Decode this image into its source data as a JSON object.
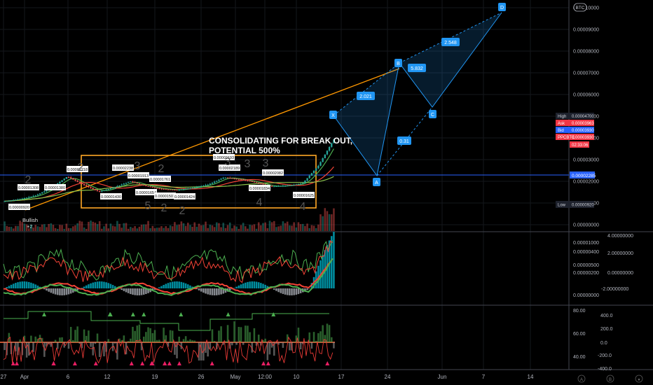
{
  "symbol_badge": "BTC",
  "colors": {
    "background": "#000000",
    "up": "#26a69a",
    "down": "#ef5350",
    "pattern": "#2196f3",
    "trendline": "#ff9800",
    "box": "#ffa726",
    "macd": "#00bcd4",
    "signal_green": "#4caf50",
    "signal_red": "#f44336"
  },
  "annotation": {
    "line1": "CONSOLIDATING FOR BREAK OUT,",
    "line2": "POTENTIAL 500%"
  },
  "bullish_label": {
    "text": "Bullish",
    "count": "+2"
  },
  "harmonic": {
    "points": [
      "X",
      "A",
      "B",
      "C",
      "D"
    ],
    "ratios": [
      "2.021",
      "5.832",
      "0.31",
      "2.548"
    ]
  },
  "price_labels": [
    "High",
    "Ask",
    "Bid",
    "PPCBTC",
    "Low"
  ],
  "chart_data": [
    {
      "type": "candlestick",
      "title": "",
      "x_ticks": [
        "27",
        "Apr",
        "6",
        "12",
        "19",
        "26",
        "May",
        "12:00",
        "10",
        "17",
        "24",
        "Jun",
        "7",
        "14"
      ],
      "y_ticks": [
        "0.00000000",
        "0.00001000",
        "0.00002000",
        "0.00003000",
        "0.00004000",
        "0.00005000",
        "0.00006000",
        "0.00007000",
        "0.00008000",
        "0.00009000",
        "0.00010000"
      ],
      "ylim": [
        0,
        0.0001
      ],
      "markers": {
        "high": "0.00004700",
        "ask": "0.00003963",
        "bid": "0.00003930",
        "last_symbol": "PPCBTC",
        "last": "0.00003930",
        "countdown": "02:33:06",
        "level": "0.00002285",
        "low": "0.00000920"
      },
      "level_labels": [
        "0.00000920",
        "0.00001308",
        "0.00001380",
        "0.00002218",
        "0.00001430",
        "0.00002238",
        "0.00001913",
        "0.00001761",
        "0.00001654",
        "0.00001501",
        "0.00001424",
        "0.00002193",
        "0.00002189",
        "0.00001834",
        "0.00002082",
        "0.00001625"
      ],
      "wave_counts": [
        "2",
        "2",
        "3",
        "2",
        "3",
        "3",
        "3",
        "4",
        "5",
        "4",
        "2",
        "2"
      ],
      "series": [
        {
          "name": "",
          "values": [
            1.08e-05,
            1.18e-05,
            1.35e-05,
            1.7e-05,
            2.22e-05,
            1.85e-05,
            1.52e-05,
            1.72e-05,
            2e-05,
            1.78e-05,
            1.65e-05,
            1.6e-05,
            1.7e-05,
            1.85e-05,
            2.18e-05,
            2.09e-05,
            1.95e-05,
            1.76e-05,
            1.8e-05,
            1.9e-05,
            2.7e-05,
            3.93e-05
          ]
        }
      ]
    },
    {
      "type": "line",
      "title": "",
      "y_ticks_left": [
        "0.00000000",
        "0.00000200",
        "0.00000400",
        "0.00000500",
        "0.00001000"
      ],
      "y_ticks_right": [
        "4.00000000",
        "2.00000000",
        "0.00000000",
        "-2.00000000"
      ]
    },
    {
      "type": "line",
      "title": "",
      "y_ticks_left": [
        "40.00",
        "60.00",
        "80.00"
      ],
      "y_ticks_right": [
        "400.0",
        "200.0",
        "0.0",
        "-200.0",
        "-400.0"
      ]
    }
  ],
  "footer_icons": [
    "A",
    "B",
    "▼"
  ]
}
